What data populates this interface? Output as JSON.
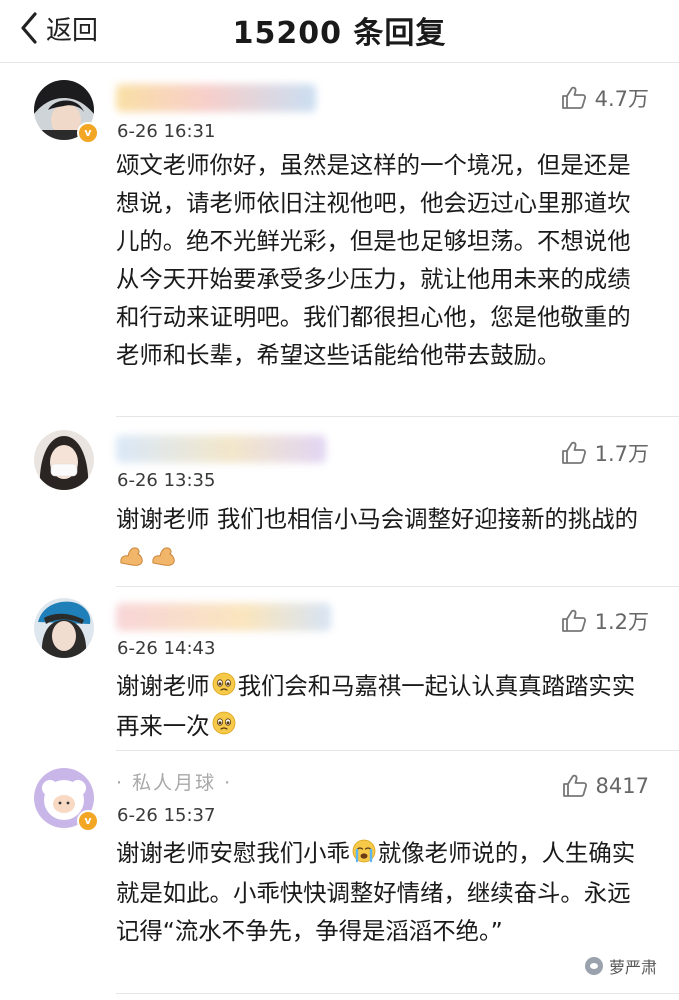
{
  "header": {
    "back_label": "返回",
    "title": "15200 条回复"
  },
  "comments": [
    {
      "time": "6-26 16:31",
      "likes": "4.7万",
      "verified": true,
      "text": "颂文老师你好，虽然是这样的一个境况，但是还是想说，请老师依旧注视他吧，他会迈过心里那道坎儿的。绝不光鲜光彩，但是也足够坦荡。不想说他从今天开始要承受多少压力，就让他用未来的成绩和行动来证明吧。我们都很担心他，您是他敬重的老师和长辈，希望这些话能给他带去鼓励。"
    },
    {
      "time": "6-26 13:35",
      "likes": "1.7万",
      "verified": false,
      "text": "谢谢老师 我们也相信小马会调整好迎接新的挑战的",
      "emojis": [
        "flexed-biceps",
        "flexed-biceps"
      ]
    },
    {
      "time": "6-26 14:43",
      "likes": "1.2万",
      "verified": false,
      "text_part1": "谢谢老师",
      "text_part2": "我们会和马嘉祺一起认认真真踏踏实实再来一次",
      "emojis": [
        "pleading-face",
        "pleading-face"
      ]
    },
    {
      "name": "· 私人月球 ·",
      "time": "6-26 15:37",
      "likes": "8417",
      "verified": true,
      "text_part1": "谢谢老师安慰我们小乖",
      "text_part2": "就像老师说的，人生确实就是如此。小乖快快调整好情绪，继续奋斗。永远记得“流水不争先，争得是滔滔不绝。”",
      "emojis": [
        "crying-face"
      ]
    }
  ],
  "watermark": {
    "text": "萝严肃"
  },
  "colors": {
    "divider": "#e6e6e6",
    "verified_badge": "#f3a524",
    "emoji_yellow": "#f7c948",
    "text": "#1a1a1a",
    "meta": "#666666"
  }
}
